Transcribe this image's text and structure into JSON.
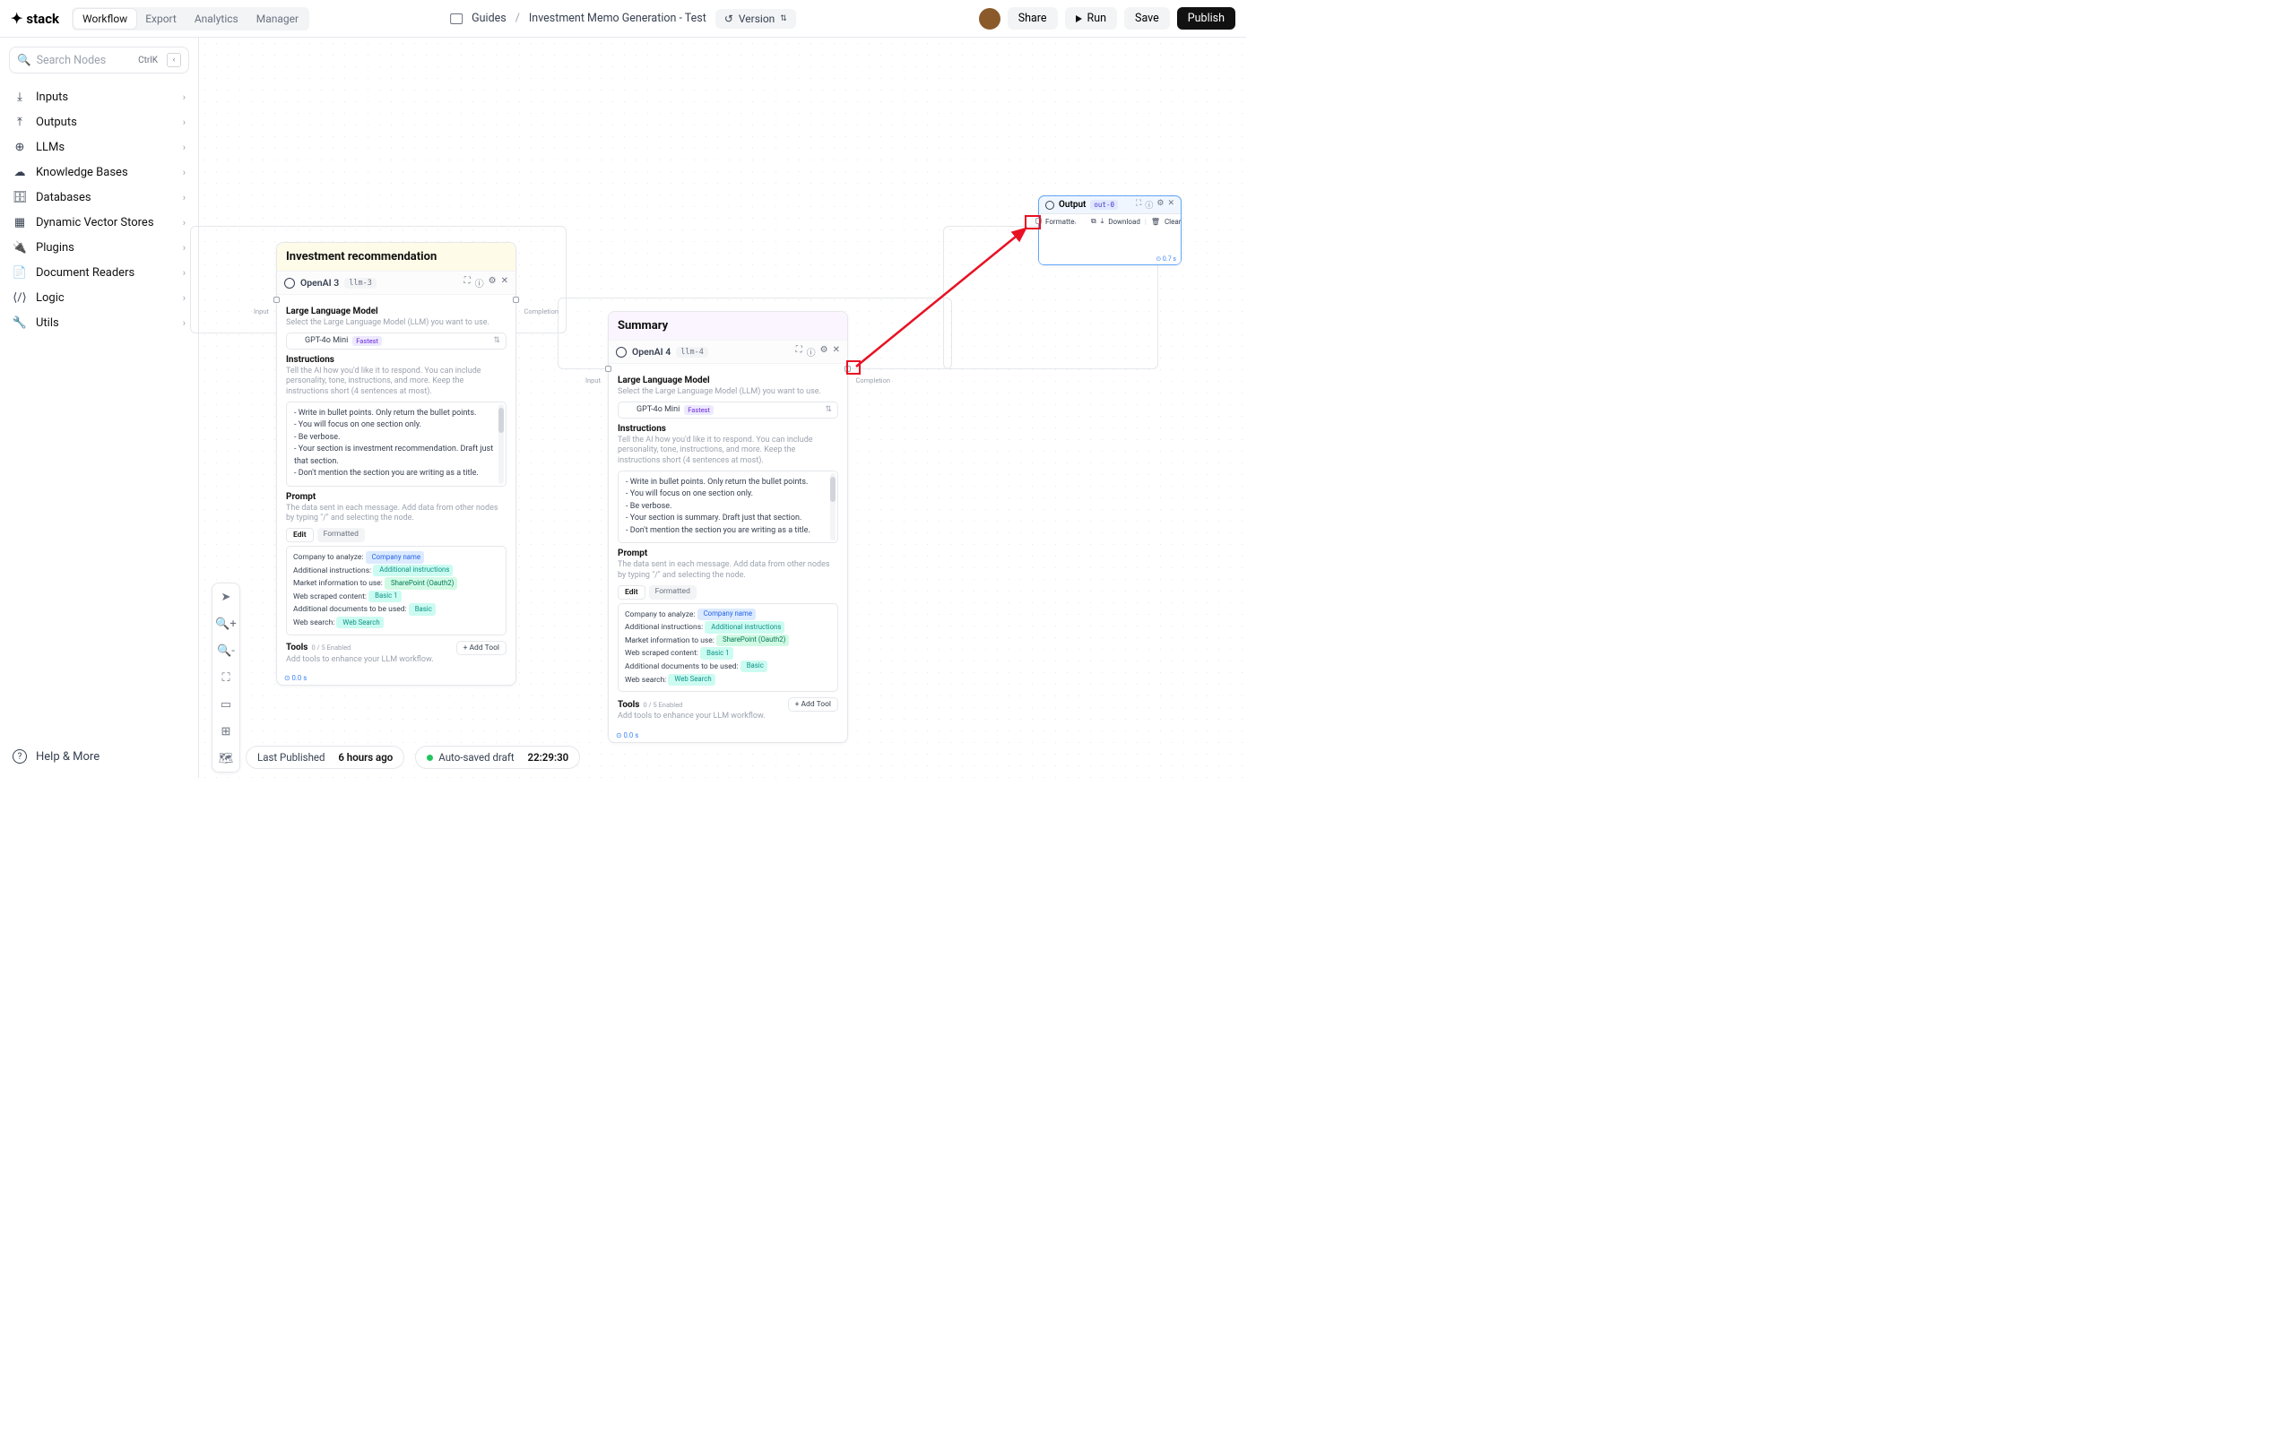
{
  "brand": "stack",
  "tabs": {
    "workflow": "Workflow",
    "export": "Export",
    "analytics": "Analytics",
    "manager": "Manager"
  },
  "crumbs": {
    "guides": "Guides",
    "current": "Investment Memo Generation - Test"
  },
  "version": "Version",
  "buttons": {
    "share": "Share",
    "run": "Run",
    "save": "Save",
    "publish": "Publish"
  },
  "search": {
    "placeholder": "Search Nodes",
    "kbd": "CtrlK"
  },
  "cats": [
    "Inputs",
    "Outputs",
    "LLMs",
    "Knowledge Bases",
    "Databases",
    "Dynamic Vector Stores",
    "Plugins",
    "Document Readers",
    "Logic",
    "Utils"
  ],
  "help": "Help & More",
  "status": {
    "lp_label": "Last Published",
    "lp_val": "6 hours ago",
    "as_label": "Auto-saved draft",
    "as_val": "22:29:30"
  },
  "node1": {
    "title": "Investment recommendation",
    "subtitle": "OpenAI 3",
    "tag": "llm-3",
    "llm_h": "Large Language Model",
    "llm_d": "Select the Large Language Model (LLM) you want to use.",
    "model": "GPT-4o Mini",
    "model_tag": "Fastest",
    "instr_h": "Instructions",
    "instr_d": "Tell the AI how you'd like it to respond. You can include personality, tone, instructions, and more. Keep the instructions short (4 sentences at most).",
    "bullets": [
      "Write in bullet points. Only return the bullet points.",
      "You will focus on one section only.",
      "Be verbose.",
      "Your section is investment recommendation. Draft just that section.",
      "Don't mention the section you are writing as a title."
    ],
    "prompt_h": "Prompt",
    "prompt_d": "The data sent in each message. Add data from other nodes by typing \"/\" and selecting the node.",
    "tab_edit": "Edit",
    "tab_fmt": "Formatted",
    "p_company": "Company to analyze:",
    "chip_company": "Company name",
    "p_addl": "Additional instructions:",
    "chip_addl": "Additional instructions",
    "p_market": "Market information to use:",
    "chip_sp": "SharePoint (Oauth2)",
    "p_web": "Web scraped content:",
    "chip_basic1": "Basic 1",
    "p_docs": "Additional documents to be used:",
    "chip_basic": "Basic",
    "p_ws": "Web search:",
    "chip_ws": "Web Search",
    "tools_h": "Tools",
    "tools_cnt": "0 / 5 Enabled",
    "tools_d": "Add tools to enhance your LLM workflow.",
    "add_tool": "+  Add Tool",
    "foot": "⊙ 0.0 s",
    "in_lbl": "Input",
    "out_lbl": "Completion"
  },
  "node2": {
    "title": "Summary",
    "subtitle": "OpenAI 4",
    "tag": "llm-4",
    "llm_h": "Large Language Model",
    "llm_d": "Select the Large Language Model (LLM) you want to use.",
    "model": "GPT-4o Mini",
    "model_tag": "Fastest",
    "instr_h": "Instructions",
    "instr_d": "Tell the AI how you'd like it to respond. You can include personality, tone, instructions, and more. Keep the instructions short (4 sentences at most).",
    "bullets": [
      "Write in bullet points. Only return the bullet points.",
      "You will focus on one section only.",
      "Be verbose.",
      "Your section is summary. Draft just that section.",
      "Don't mention the section you are writing as a title."
    ],
    "prompt_h": "Prompt",
    "prompt_d": "The data sent in each message. Add data from other nodes by typing \"/\" and selecting the node.",
    "tab_edit": "Edit",
    "tab_fmt": "Formatted",
    "p_company": "Company to analyze:",
    "chip_company": "Company name",
    "p_addl": "Additional instructions:",
    "chip_addl": "Additional instructions",
    "p_market": "Market information to use:",
    "chip_sp": "SharePoint (Oauth2)",
    "p_web": "Web scraped content:",
    "chip_basic1": "Basic 1",
    "p_docs": "Additional documents to be used:",
    "chip_basic": "Basic",
    "p_ws": "Web search:",
    "chip_ws": "Web Search",
    "tools_h": "Tools",
    "tools_cnt": "0 / 5 Enabled",
    "tools_d": "Add tools to enhance your LLM workflow.",
    "add_tool": "+  Add Tool",
    "foot": "⊙ 0.0 s",
    "in_lbl": "Input",
    "out_lbl": "Completion"
  },
  "output": {
    "title": "Output",
    "tag": "out-0",
    "fmt": "Formatted",
    "dl": "Download",
    "clr": "Clear",
    "ft": "⊙ 0.7 s"
  }
}
